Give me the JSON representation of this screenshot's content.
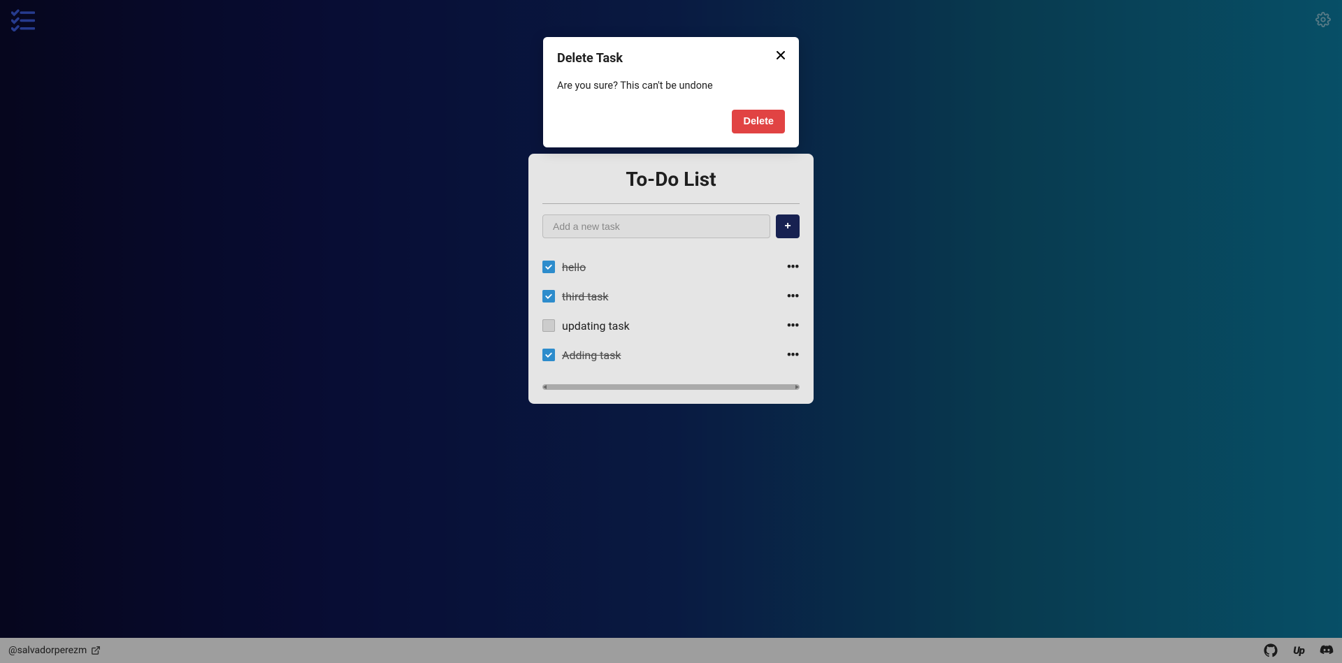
{
  "topbar": {},
  "card": {
    "title": "To-Do List",
    "input_placeholder": "Add a new task",
    "add_label": "+",
    "tasks": [
      {
        "label": "hello",
        "done": true
      },
      {
        "label": "third task",
        "done": true
      },
      {
        "label": "updating task",
        "done": false
      },
      {
        "label": "Adding task",
        "done": true
      }
    ]
  },
  "modal": {
    "title": "Delete Task",
    "body": "Are you sure? This can't be undone",
    "delete_label": "Delete"
  },
  "footer": {
    "user": "@salvadorperezm"
  }
}
